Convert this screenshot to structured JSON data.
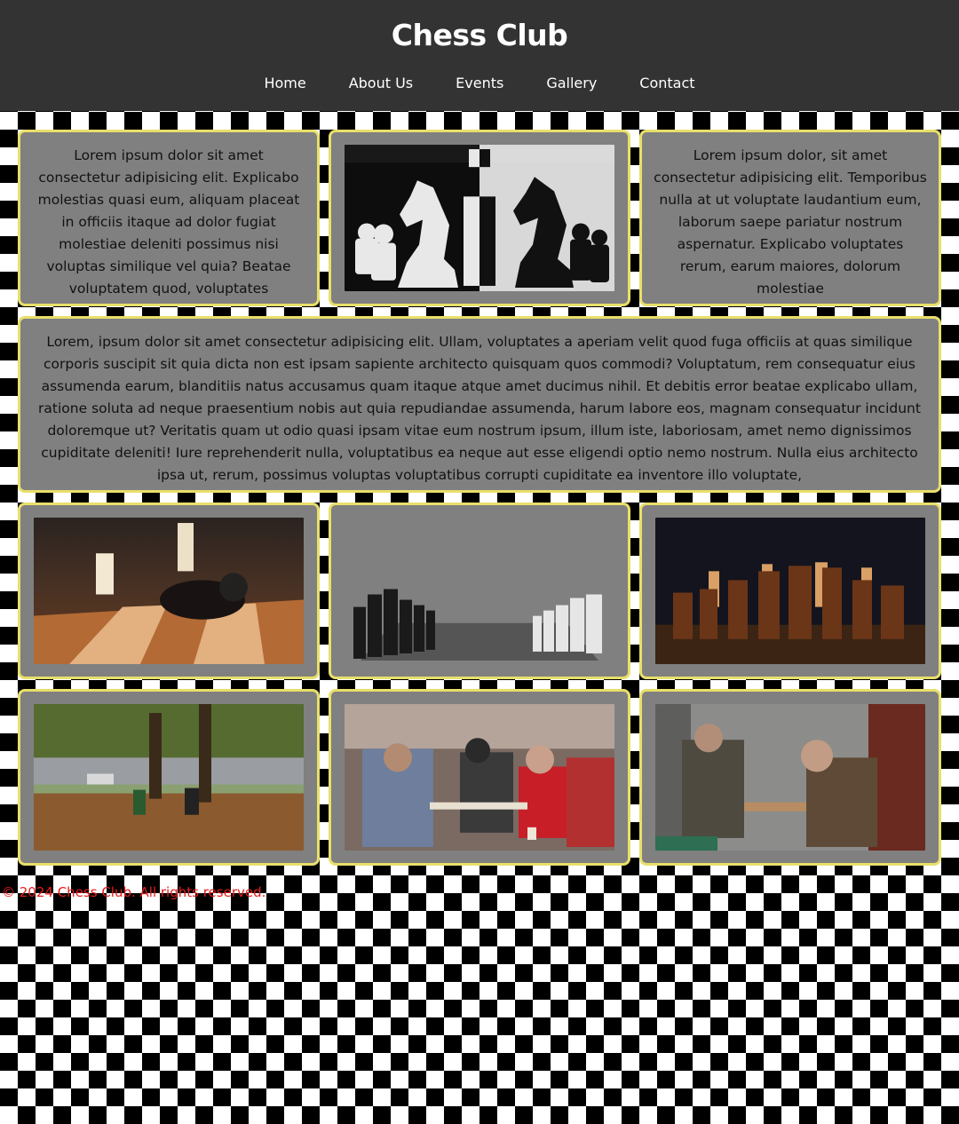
{
  "header": {
    "title": "Chess Club",
    "nav": [
      "Home",
      "About Us",
      "Events",
      "Gallery",
      "Contact"
    ]
  },
  "top_row": {
    "left_text": "Lorem ipsum dolor sit amet consectetur adipisicing elit. Explicabo molestias quasi eum, aliquam placeat in officiis itaque ad dolor fugiat molestiae deleniti possimus nisi voluptas similique vel quia? Beatae voluptatem quod, voluptates",
    "right_text": "Lorem ipsum dolor, sit amet consectetur adipisicing elit. Temporibus nulla at ut voluptate laudantium eum, laborum saepe pariatur nostrum aspernatur. Explicabo voluptates rerum, earum maiores, dolorum molestiae"
  },
  "wide_text": "Lorem, ipsum dolor sit amet consectetur adipisicing elit. Ullam, voluptates a aperiam velit quod fuga officiis at quas similique corporis suscipit sit quia dicta non est ipsam sapiente architecto quisquam quos commodi? Voluptatum, rem consequatur eius assumenda earum, blanditiis natus accusamus quam itaque atque amet ducimus nihil. Et debitis error beatae explicabo ullam, ratione soluta ad neque praesentium nobis aut quia repudiandae assumenda, harum labore eos, magnam consequatur incidunt doloremque ut? Veritatis quam ut odio quasi ipsam vitae eum nostrum ipsum, illum iste, laboriosam, amet nemo dignissimos cupiditate deleniti! Iure reprehenderit nulla, voluptatibus ea neque aut esse eligendi optio nemo nostrum. Nulla eius architecto ipsa ut, rerum, possimus voluptas voluptatibus corrupti cupiditate ea inventore illo voluptate,",
  "footer": {
    "text": "© 2024 Chess Club. All rights reserved."
  },
  "colors": {
    "header_bg": "#333333",
    "card_bg": "#808080",
    "card_border": "#e8df6a",
    "footer_text": "#e41c1c"
  }
}
